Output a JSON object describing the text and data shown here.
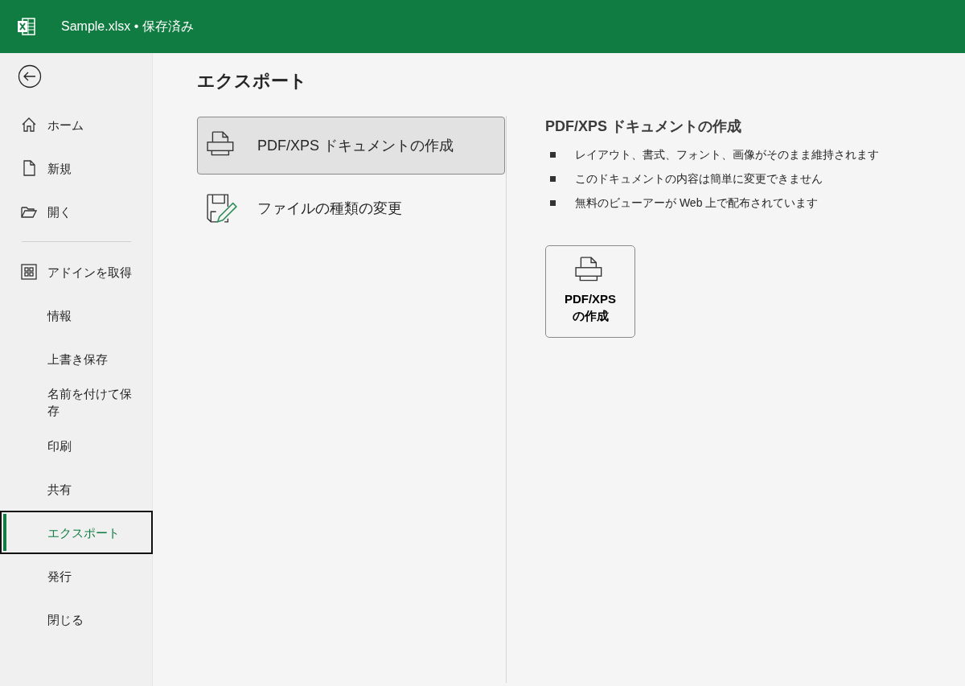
{
  "title_bar": {
    "file_name": "Sample.xlsx",
    "separator": "•",
    "status": "保存済み"
  },
  "sidebar": {
    "top_items": [
      {
        "label": "ホーム",
        "kind": "home",
        "selected": false
      },
      {
        "label": "新規",
        "kind": "new",
        "selected": false
      },
      {
        "label": "開く",
        "kind": "open",
        "selected": false
      }
    ],
    "items": [
      {
        "label": "アドインを取得",
        "kind": "addins",
        "selected": false
      },
      {
        "label": "情報",
        "kind": "plain",
        "selected": false
      },
      {
        "label": "上書き保存",
        "kind": "plain",
        "selected": false
      },
      {
        "label": "名前を付けて保存",
        "kind": "plain",
        "selected": false
      },
      {
        "label": "印刷",
        "kind": "plain",
        "selected": false
      },
      {
        "label": "共有",
        "kind": "plain",
        "selected": false
      },
      {
        "label": "エクスポート",
        "kind": "plain",
        "selected": true
      },
      {
        "label": "発行",
        "kind": "plain",
        "selected": false
      },
      {
        "label": "閉じる",
        "kind": "plain",
        "selected": false
      }
    ]
  },
  "page_title": "エクスポート",
  "options": [
    {
      "label": "PDF/XPS ドキュメントの作成",
      "kind": "pdf",
      "selected": true
    },
    {
      "label": "ファイルの種類の変更",
      "kind": "change_type",
      "selected": false
    }
  ],
  "detail": {
    "title": "PDF/XPS ドキュメントの作成",
    "bullets": [
      "レイアウト、書式、フォント、画像がそのまま維持されます",
      "このドキュメントの内容は簡単に変更できません",
      "無料のビューアーが Web 上で配布されています"
    ],
    "button": "PDF/XPS\nの作成"
  }
}
